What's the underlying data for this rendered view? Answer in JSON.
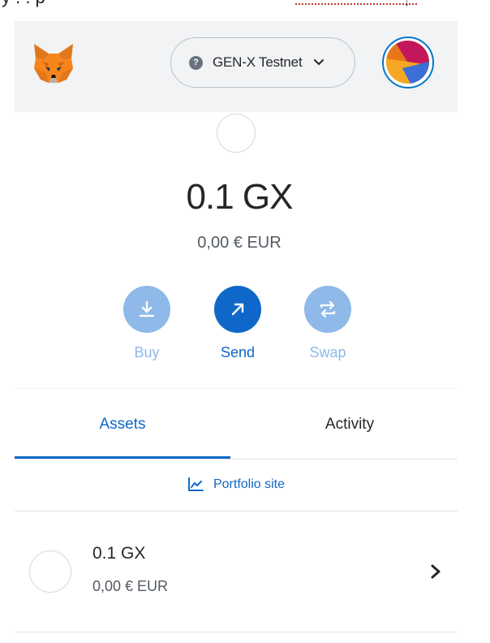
{
  "page_top": {
    "clipped_text": "y    .     .       p"
  },
  "header": {
    "network_label": "GEN-X Testnet",
    "network_icon_glyph": "?"
  },
  "balance": {
    "primary": "0.1 GX",
    "secondary": "0,00 € EUR"
  },
  "actions": {
    "buy_label": "Buy",
    "send_label": "Send",
    "swap_label": "Swap"
  },
  "tabs": [
    {
      "label": "Assets",
      "active": true
    },
    {
      "label": "Activity",
      "active": false
    }
  ],
  "portfolio": {
    "label": "Portfolio site"
  },
  "assets": [
    {
      "primary": "0.1 GX",
      "secondary": "0,00 € EUR"
    }
  ],
  "colors": {
    "accent": "#0f68c9",
    "accent_light": "#8eb9e8",
    "header_bg": "#f2f3f4"
  }
}
